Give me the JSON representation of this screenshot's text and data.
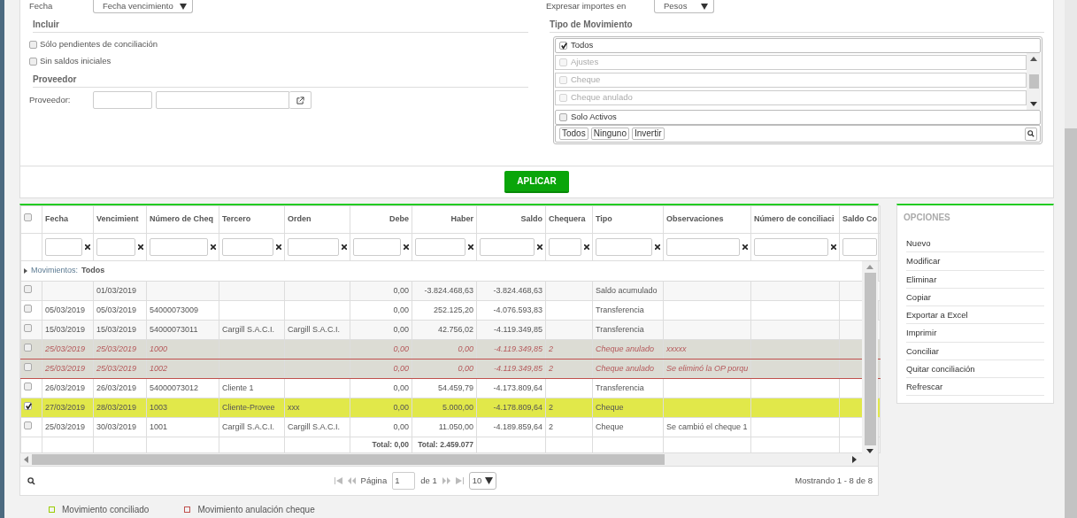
{
  "filters": {
    "fecha": {
      "label": "Fecha",
      "value": "Fecha vencimiento"
    },
    "incluir": {
      "title": "Incluir",
      "options": [
        {
          "label": "Sólo pendientes de conciliación",
          "checked": false
        },
        {
          "label": "Sin saldos iniciales",
          "checked": false
        }
      ]
    },
    "proveedor": {
      "title": "Proveedor",
      "label": "Proveedor:"
    },
    "expresar": {
      "label": "Expresar importes en",
      "value": "Pesos"
    },
    "tipo_movimiento": {
      "title": "Tipo de Movimiento",
      "todos": {
        "label": "Todos",
        "checked": true
      },
      "items": [
        {
          "label": "Ajustes",
          "checked": false,
          "disabled": true
        },
        {
          "label": "Cheque",
          "checked": false,
          "disabled": true
        },
        {
          "label": "Cheque anulado",
          "checked": false,
          "disabled": true
        }
      ],
      "solo_activos": {
        "label": "Solo Activos",
        "checked": false
      },
      "buttons": [
        "Todos",
        "Ninguno",
        "Invertir"
      ]
    },
    "apply_button": "APLICAR"
  },
  "grid": {
    "select_all": {
      "checked": false
    },
    "columns": [
      {
        "label": "Fecha"
      },
      {
        "label": "Vencimient"
      },
      {
        "label": "Número de Cheq"
      },
      {
        "label": "Tercero"
      },
      {
        "label": "Orden"
      },
      {
        "label": "Debe",
        "numeric": true,
        "total": "Total: 0,00"
      },
      {
        "label": "Haber",
        "numeric": true,
        "total": "Total: 2.459.077"
      },
      {
        "label": "Saldo",
        "numeric": true
      },
      {
        "label": "Chequera"
      },
      {
        "label": "Tipo"
      },
      {
        "label": "Observaciones"
      },
      {
        "label": "Número de conciliaci"
      },
      {
        "label": "Saldo Co"
      }
    ],
    "group_row": {
      "label": "Movimientos:",
      "value": "Todos"
    },
    "rows": [
      {
        "kind": "normal",
        "selected": false,
        "cells": [
          null,
          "01/03/2019",
          null,
          null,
          null,
          "0,00",
          "-3.824.468,63",
          "-3.824.468,63",
          null,
          "Saldo acumulado",
          null,
          null,
          null
        ]
      },
      {
        "kind": "normal",
        "selected": false,
        "cells": [
          "05/03/2019",
          "05/03/2019",
          "54000073009",
          null,
          null,
          "0,00",
          "252.125,20",
          "-4.076.593,83",
          null,
          "Transferencia",
          null,
          null,
          null
        ]
      },
      {
        "kind": "normal",
        "selected": false,
        "cells": [
          "15/03/2019",
          "15/03/2019",
          "54000073011",
          "Cargill S.A.C.I.",
          "Cargill S.A.C.I.",
          "0,00",
          "42.756,02",
          "-4.119.349,85",
          null,
          "Transferencia",
          null,
          null,
          null
        ]
      },
      {
        "kind": "annulled",
        "selected": false,
        "cells": [
          "25/03/2019",
          "25/03/2019",
          "1000",
          null,
          null,
          "0,00",
          "0,00",
          "-4.119.349,85",
          "2",
          "Cheque anulado",
          "xxxxx",
          null,
          null
        ]
      },
      {
        "kind": "annulled",
        "selected": false,
        "cells": [
          "25/03/2019",
          "25/03/2019",
          "1002",
          null,
          null,
          "0,00",
          "0,00",
          "-4.119.349,85",
          "2",
          "Cheque anulado",
          "Se eliminó la OP porqu",
          null,
          null
        ]
      },
      {
        "kind": "normal",
        "selected": false,
        "cells": [
          "26/03/2019",
          "26/03/2019",
          "54000073012",
          "Cliente 1",
          null,
          "0,00",
          "54.459,79",
          "-4.173.809,64",
          null,
          "Transferencia",
          null,
          null,
          null
        ]
      },
      {
        "kind": "normal",
        "selected": true,
        "cells": [
          "27/03/2019",
          "28/03/2019",
          "1003",
          "Cliente-Provee",
          "xxx",
          "0,00",
          "5.000,00",
          "-4.178.809,64",
          "2",
          "Cheque",
          null,
          null,
          null
        ]
      },
      {
        "kind": "normal",
        "selected": false,
        "cells": [
          "25/03/2019",
          "30/03/2019",
          "1001",
          "Cargill S.A.C.I.",
          "Cargill S.A.C.I.",
          "0,00",
          "11.050,00",
          "-4.189.859,64",
          "2",
          "Cheque",
          "Se cambió el cheque 1",
          null,
          null
        ]
      }
    ],
    "pager": {
      "page_label": "Página",
      "page": "1",
      "of": "de 1",
      "page_size": "10",
      "summary": "Mostrando 1 - 8 de 8"
    }
  },
  "options": {
    "title": "OPCIONES",
    "items": [
      "Nuevo",
      "Modificar",
      "Eliminar",
      "Copiar",
      "Exportar a Excel",
      "Imprimir",
      "Conciliar",
      "Quitar conciliación",
      "Refrescar"
    ]
  },
  "legend": [
    {
      "label": "Movimiento conciliado",
      "color": "#99cc00"
    },
    {
      "label": "Movimiento anulación cheque",
      "color": "#c0504d"
    }
  ]
}
